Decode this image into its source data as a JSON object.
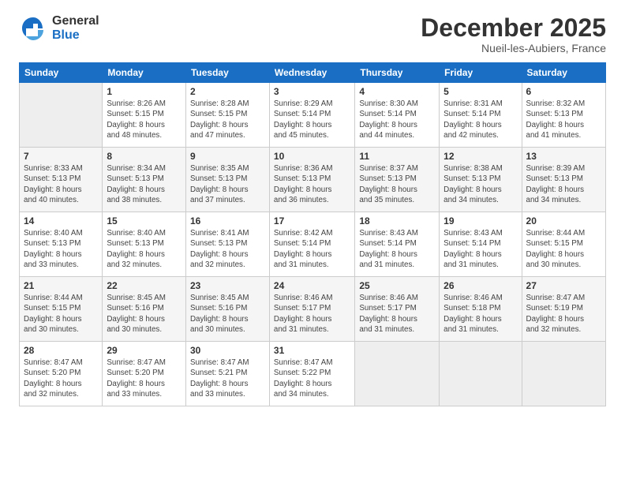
{
  "logo": {
    "general": "General",
    "blue": "Blue"
  },
  "title": "December 2025",
  "subtitle": "Nueil-les-Aubiers, France",
  "headers": [
    "Sunday",
    "Monday",
    "Tuesday",
    "Wednesday",
    "Thursday",
    "Friday",
    "Saturday"
  ],
  "weeks": [
    [
      {
        "num": "",
        "info": "",
        "empty": true
      },
      {
        "num": "1",
        "info": "Sunrise: 8:26 AM\nSunset: 5:15 PM\nDaylight: 8 hours\nand 48 minutes."
      },
      {
        "num": "2",
        "info": "Sunrise: 8:28 AM\nSunset: 5:15 PM\nDaylight: 8 hours\nand 47 minutes."
      },
      {
        "num": "3",
        "info": "Sunrise: 8:29 AM\nSunset: 5:14 PM\nDaylight: 8 hours\nand 45 minutes."
      },
      {
        "num": "4",
        "info": "Sunrise: 8:30 AM\nSunset: 5:14 PM\nDaylight: 8 hours\nand 44 minutes."
      },
      {
        "num": "5",
        "info": "Sunrise: 8:31 AM\nSunset: 5:14 PM\nDaylight: 8 hours\nand 42 minutes."
      },
      {
        "num": "6",
        "info": "Sunrise: 8:32 AM\nSunset: 5:13 PM\nDaylight: 8 hours\nand 41 minutes."
      }
    ],
    [
      {
        "num": "7",
        "info": "Sunrise: 8:33 AM\nSunset: 5:13 PM\nDaylight: 8 hours\nand 40 minutes."
      },
      {
        "num": "8",
        "info": "Sunrise: 8:34 AM\nSunset: 5:13 PM\nDaylight: 8 hours\nand 38 minutes."
      },
      {
        "num": "9",
        "info": "Sunrise: 8:35 AM\nSunset: 5:13 PM\nDaylight: 8 hours\nand 37 minutes."
      },
      {
        "num": "10",
        "info": "Sunrise: 8:36 AM\nSunset: 5:13 PM\nDaylight: 8 hours\nand 36 minutes."
      },
      {
        "num": "11",
        "info": "Sunrise: 8:37 AM\nSunset: 5:13 PM\nDaylight: 8 hours\nand 35 minutes."
      },
      {
        "num": "12",
        "info": "Sunrise: 8:38 AM\nSunset: 5:13 PM\nDaylight: 8 hours\nand 34 minutes."
      },
      {
        "num": "13",
        "info": "Sunrise: 8:39 AM\nSunset: 5:13 PM\nDaylight: 8 hours\nand 34 minutes."
      }
    ],
    [
      {
        "num": "14",
        "info": "Sunrise: 8:40 AM\nSunset: 5:13 PM\nDaylight: 8 hours\nand 33 minutes."
      },
      {
        "num": "15",
        "info": "Sunrise: 8:40 AM\nSunset: 5:13 PM\nDaylight: 8 hours\nand 32 minutes."
      },
      {
        "num": "16",
        "info": "Sunrise: 8:41 AM\nSunset: 5:13 PM\nDaylight: 8 hours\nand 32 minutes."
      },
      {
        "num": "17",
        "info": "Sunrise: 8:42 AM\nSunset: 5:14 PM\nDaylight: 8 hours\nand 31 minutes."
      },
      {
        "num": "18",
        "info": "Sunrise: 8:43 AM\nSunset: 5:14 PM\nDaylight: 8 hours\nand 31 minutes."
      },
      {
        "num": "19",
        "info": "Sunrise: 8:43 AM\nSunset: 5:14 PM\nDaylight: 8 hours\nand 31 minutes."
      },
      {
        "num": "20",
        "info": "Sunrise: 8:44 AM\nSunset: 5:15 PM\nDaylight: 8 hours\nand 30 minutes."
      }
    ],
    [
      {
        "num": "21",
        "info": "Sunrise: 8:44 AM\nSunset: 5:15 PM\nDaylight: 8 hours\nand 30 minutes."
      },
      {
        "num": "22",
        "info": "Sunrise: 8:45 AM\nSunset: 5:16 PM\nDaylight: 8 hours\nand 30 minutes."
      },
      {
        "num": "23",
        "info": "Sunrise: 8:45 AM\nSunset: 5:16 PM\nDaylight: 8 hours\nand 30 minutes."
      },
      {
        "num": "24",
        "info": "Sunrise: 8:46 AM\nSunset: 5:17 PM\nDaylight: 8 hours\nand 31 minutes."
      },
      {
        "num": "25",
        "info": "Sunrise: 8:46 AM\nSunset: 5:17 PM\nDaylight: 8 hours\nand 31 minutes."
      },
      {
        "num": "26",
        "info": "Sunrise: 8:46 AM\nSunset: 5:18 PM\nDaylight: 8 hours\nand 31 minutes."
      },
      {
        "num": "27",
        "info": "Sunrise: 8:47 AM\nSunset: 5:19 PM\nDaylight: 8 hours\nand 32 minutes."
      }
    ],
    [
      {
        "num": "28",
        "info": "Sunrise: 8:47 AM\nSunset: 5:20 PM\nDaylight: 8 hours\nand 32 minutes."
      },
      {
        "num": "29",
        "info": "Sunrise: 8:47 AM\nSunset: 5:20 PM\nDaylight: 8 hours\nand 33 minutes."
      },
      {
        "num": "30",
        "info": "Sunrise: 8:47 AM\nSunset: 5:21 PM\nDaylight: 8 hours\nand 33 minutes."
      },
      {
        "num": "31",
        "info": "Sunrise: 8:47 AM\nSunset: 5:22 PM\nDaylight: 8 hours\nand 34 minutes."
      },
      {
        "num": "",
        "info": "",
        "empty": true
      },
      {
        "num": "",
        "info": "",
        "empty": true
      },
      {
        "num": "",
        "info": "",
        "empty": true
      }
    ]
  ]
}
